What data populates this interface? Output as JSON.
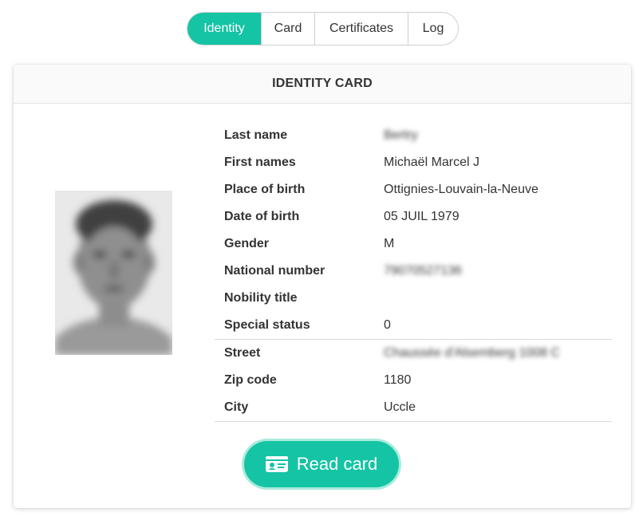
{
  "tabs": [
    {
      "label": "Identity",
      "active": true
    },
    {
      "label": "Card",
      "active": false
    },
    {
      "label": "Certificates",
      "active": false
    },
    {
      "label": "Log",
      "active": false
    }
  ],
  "card": {
    "title": "IDENTITY CARD",
    "photo_icon": "portrait-photo",
    "fields": [
      {
        "label": "Last name",
        "value": "Bertry",
        "blurred": true
      },
      {
        "label": "First names",
        "value": "Michaël Marcel J",
        "blurred": false
      },
      {
        "label": "Place of birth",
        "value": "Ottignies-Louvain-la-Neuve",
        "blurred": false
      },
      {
        "label": "Date of birth",
        "value": "05 JUIL 1979",
        "blurred": false
      },
      {
        "label": "Gender",
        "value": "M",
        "blurred": false
      },
      {
        "label": "National number",
        "value": "79070527136",
        "blurred": true
      },
      {
        "label": "Nobility title",
        "value": "",
        "blurred": false
      },
      {
        "label": "Special status",
        "value": "0",
        "blurred": false
      },
      {
        "label": "Street",
        "value": "Chaussée d'Alsemberg 1008 C",
        "blurred": true
      },
      {
        "label": "Zip code",
        "value": "1180",
        "blurred": false
      },
      {
        "label": "City",
        "value": "Uccle",
        "blurred": false
      }
    ],
    "read_button": {
      "label": "Read card",
      "icon": "id-card-icon"
    }
  },
  "colors": {
    "accent": "#14c4a4",
    "accent_ring": "#a9ebdd"
  }
}
